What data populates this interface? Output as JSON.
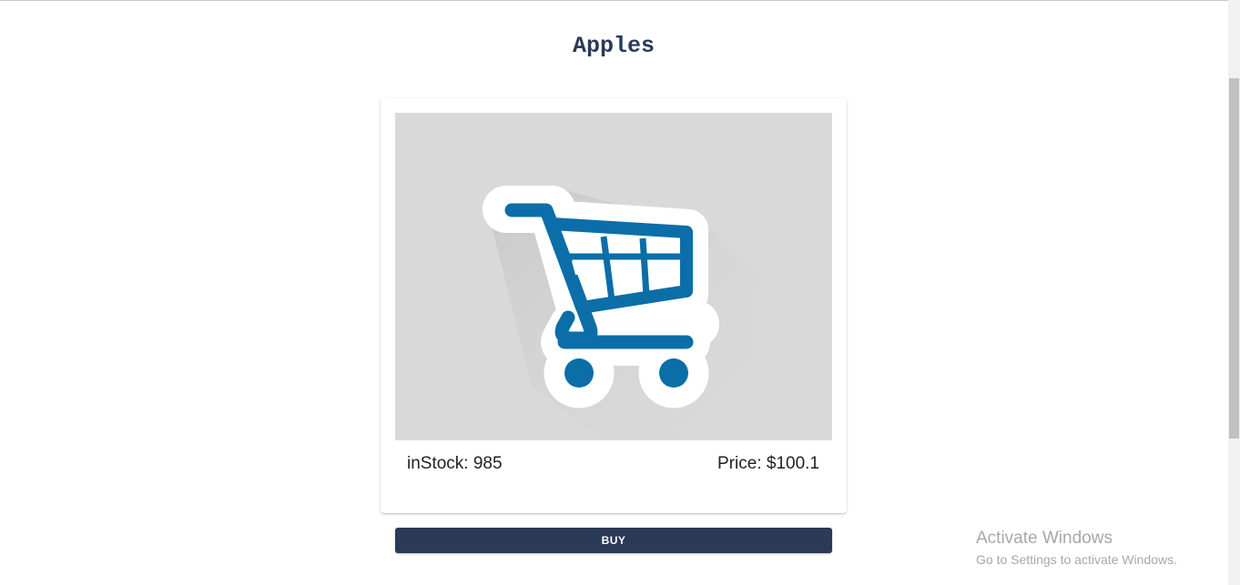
{
  "product": {
    "title": "Apples",
    "image_icon": "shopping-cart-icon",
    "in_stock_label": "inStock: 985",
    "price_label": "Price: $100.1"
  },
  "actions": {
    "buy_label": "BUY"
  },
  "watermark": {
    "title": "Activate Windows",
    "subtitle": "Go to Settings to activate Windows."
  },
  "colors": {
    "title": "#2a3a57",
    "button": "#2a3a57",
    "cart_blue": "#0b6ea8",
    "image_bg": "#d9d9d9"
  }
}
